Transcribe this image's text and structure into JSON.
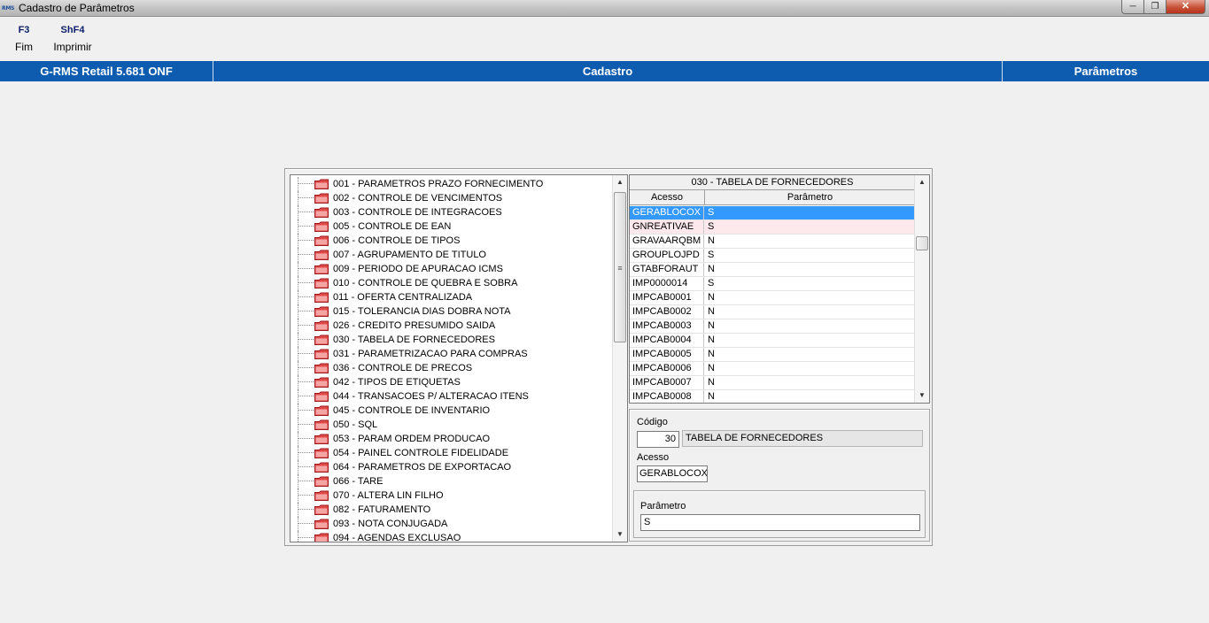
{
  "window": {
    "title": "Cadastro de Parâmetros",
    "icon_label": "RMS",
    "controls": [
      "minimize",
      "maximize",
      "close"
    ]
  },
  "function_keys": [
    {
      "key": "F3",
      "label": "Fim"
    },
    {
      "key": "ShF4",
      "label": "Imprimir"
    }
  ],
  "header_bar": {
    "product": "G-RMS Retail 5.681 ONF",
    "module": "Cadastro",
    "screen": "Parâmetros",
    "color": "#0e5cb0"
  },
  "tree": {
    "items": [
      "001 - PARAMETROS PRAZO FORNECIMENTO",
      "002 - CONTROLE DE VENCIMENTOS",
      "003 - CONTROLE DE INTEGRACOES",
      "005 - CONTROLE DE EAN",
      "006 - CONTROLE DE TIPOS",
      "007 - AGRUPAMENTO DE TITULO",
      "009 - PERIODO DE APURACAO ICMS",
      "010 - CONTROLE DE QUEBRA E SOBRA",
      "011 - OFERTA CENTRALIZADA",
      "015 - TOLERANCIA DIAS DOBRA NOTA",
      "026 - CREDITO PRESUMIDO SAIDA",
      "030 - TABELA DE FORNECEDORES",
      "031 - PARAMETRIZACAO PARA COMPRAS",
      "036 - CONTROLE DE PRECOS",
      "042 - TIPOS DE ETIQUETAS",
      "044 - TRANSACOES P/ ALTERACAO ITENS",
      "045 - CONTROLE DE INVENTARIO",
      "050 - SQL",
      "053 - PARAM ORDEM PRODUCAO",
      "054 - PAINEL CONTROLE FIDELIDADE",
      "064 - PARAMETROS DE EXPORTACAO",
      "066 - TARE",
      "070 - ALTERA LIN FILHO",
      "082 - FATURAMENTO",
      "093 - NOTA CONJUGADA",
      "094 - AGENDAS EXCLUSAO"
    ],
    "folder_icon": "folder-icon",
    "folder_color": "#e24848"
  },
  "grid": {
    "title": "030 - TABELA DE FORNECEDORES",
    "columns": [
      "Acesso",
      "Parâmetro"
    ],
    "selected_color": "#3399ff",
    "rows": [
      {
        "acesso": "GERABLOCOX",
        "parametro": "S"
      },
      {
        "acesso": "GNREATIVAE",
        "parametro": "S"
      },
      {
        "acesso": "GRAVAARQBM",
        "parametro": "N"
      },
      {
        "acesso": "GROUPLOJPD",
        "parametro": "S"
      },
      {
        "acesso": "GTABFORAUT",
        "parametro": "N"
      },
      {
        "acesso": "IMP0000014",
        "parametro": "S"
      },
      {
        "acesso": "IMPCAB0001",
        "parametro": "N"
      },
      {
        "acesso": "IMPCAB0002",
        "parametro": "N"
      },
      {
        "acesso": "IMPCAB0003",
        "parametro": "N"
      },
      {
        "acesso": "IMPCAB0004",
        "parametro": "N"
      },
      {
        "acesso": "IMPCAB0005",
        "parametro": "N"
      },
      {
        "acesso": "IMPCAB0006",
        "parametro": "N"
      },
      {
        "acesso": "IMPCAB0007",
        "parametro": "N"
      },
      {
        "acesso": "IMPCAB0008",
        "parametro": "N"
      }
    ]
  },
  "detail": {
    "codigo_label": "Código",
    "codigo_value": "30",
    "codigo_desc": "TABELA DE FORNECEDORES",
    "acesso_label": "Acesso",
    "acesso_value": "GERABLOCOX",
    "parametro_label": "Parâmetro",
    "parametro_value": "S"
  }
}
